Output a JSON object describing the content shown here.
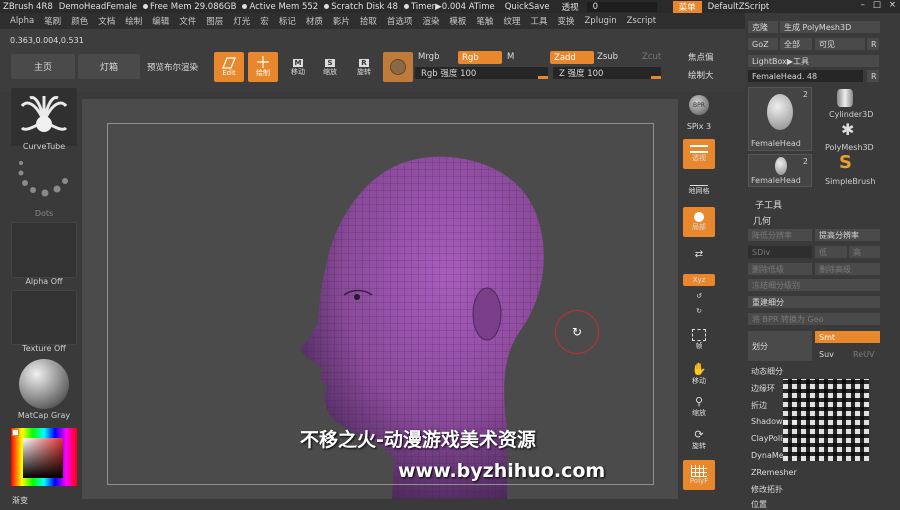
{
  "titlebar": {
    "app": "ZBrush 4R8",
    "doc": "DemoHeadFemale",
    "free_mem": "Free Mem 29.086GB",
    "active_mem": "Active Mem 552",
    "scratch": "Scratch Disk 48",
    "timer": "Timer▶0.004 ATime",
    "quicksave": "QuickSave",
    "transp_label": "透视",
    "transp_value": "0",
    "menu_label": "菜单",
    "script": "DefaultZScript"
  },
  "menubar": [
    "Alpha",
    "笔刷",
    "颜色",
    "文档",
    "绘制",
    "编辑",
    "文件",
    "图层",
    "灯光",
    "宏",
    "标记",
    "材质",
    "影片",
    "拾取",
    "首选项",
    "渲染",
    "模板",
    "笔触",
    "纹理",
    "工具",
    "变换",
    "Zplugin",
    "Zscript"
  ],
  "toolbar": {
    "coords": "0.363,0.004,0.531",
    "home": "主页",
    "lightbox": "灯箱",
    "bpr_preview": "预览布尔渲染",
    "edit": "Edit",
    "draw": "绘制",
    "move": "移动",
    "scale": "缩放",
    "rotate": "旋转",
    "mrgb": "Mrgb",
    "rgb": "Rgb",
    "m": "M",
    "zadd": "Zadd",
    "zsub": "Zsub",
    "zcut": "Zcut",
    "rgb_intensity": "Rgb 强度 100",
    "z_intensity": "Z 强度 100",
    "focal_shift": "焦点偏",
    "draw_size": "绘制大"
  },
  "leftpanel": {
    "brush": "CurveTube",
    "stroke": "Dots",
    "alpha": "Alpha Off",
    "texture": "Texture Off",
    "material": "MatCap Gray",
    "gradient": "渐变"
  },
  "rstrip": {
    "bpr": "BPR",
    "spix": "SPix 3",
    "persp": "透视",
    "floor": "地网格",
    "local": "局部",
    "xyz": "Xyz",
    "frame": "帧",
    "move": "移动",
    "scale": "缩放",
    "rotate": "旋转",
    "polyf": "PolyF"
  },
  "rpanel": {
    "clone": "克隆",
    "make_polymesh": "生成 PolyMesh3D",
    "goz": "GoZ",
    "all": "全部",
    "visible": "可见",
    "r": "R",
    "lightbox_tool": "LightBox▶工具",
    "current_tool": "FemaleHead. 48",
    "tools": [
      {
        "name": "FemaleHead",
        "count": "2"
      },
      {
        "name": "Cylinder3D",
        "count": ""
      },
      {
        "name": "PolyMesh3D",
        "count": ""
      },
      {
        "name": "FemaleHead",
        "count": "2"
      },
      {
        "name": "SimpleBrush",
        "count": ""
      }
    ],
    "subtool": "子工具",
    "geometry": "几何",
    "lower_res": "降低分辨率",
    "higher_res": "提高分辨率",
    "sdiv": "SDiv",
    "lower": "低",
    "higher": "高",
    "del_lower": "删除低级",
    "del_higher": "删除高级",
    "freeze": "冻结细分级别",
    "reconstruct": "重建细分",
    "bpr_to_geo": "将 BPR 转换为 Geo",
    "divide": "划分",
    "smt": "Smt",
    "suv": "Suv",
    "reuv": "ReUV",
    "dynamic_subdiv": "动态细分",
    "edge_loop": "边缘环",
    "crease": "折边",
    "shadowbox": "ShadowBox",
    "claypolish": "ClayPolish",
    "dynamesh": "DynaMesh",
    "zremesher": "ZRemesher",
    "modify_topo": "修改拓扑",
    "position": "位置"
  },
  "watermark": {
    "cn": "不移之火-动漫游戏美术资源",
    "url": "www.byzhihuo.com"
  },
  "colors": {
    "accent": "#e8872c",
    "mesh": "#8a4a9a"
  }
}
